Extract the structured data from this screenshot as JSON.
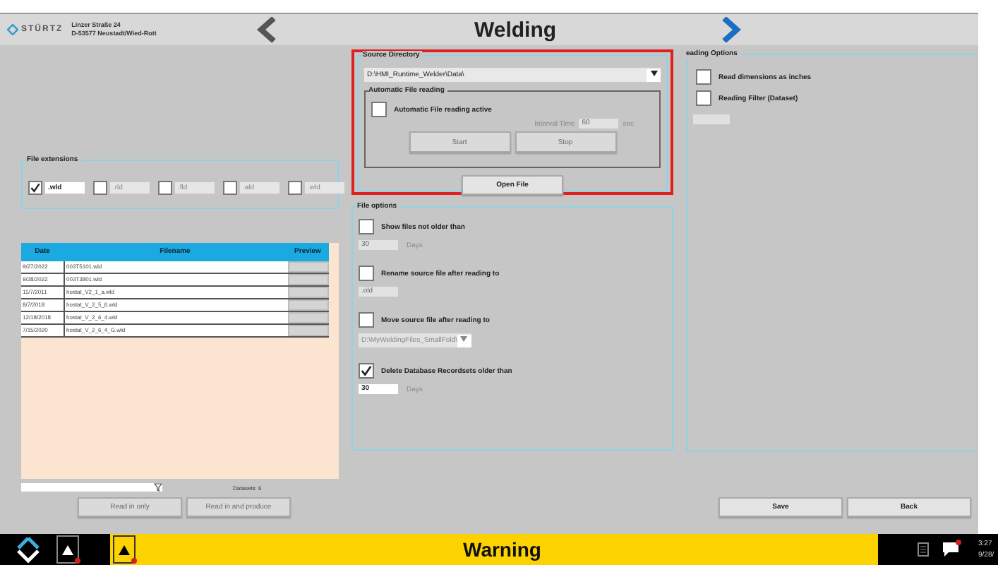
{
  "header": {
    "logo_text": "STÜRTZ",
    "address_lines": [
      "Linzer Straße 24",
      "D-53577 Neustadt/Wied-Rott"
    ],
    "title": "Welding"
  },
  "file_extensions": {
    "label": "File extensions",
    "items": [
      {
        "label": ".wld",
        "checked": true
      },
      {
        "label": ".rld",
        "checked": false
      },
      {
        "label": ".fld",
        "checked": false
      },
      {
        "label": ".ald",
        "checked": false
      },
      {
        "label": ".wld",
        "checked": false
      }
    ]
  },
  "table": {
    "columns": [
      "Date",
      "Filename",
      "Preview"
    ],
    "rows": [
      {
        "date": "9/27/2022",
        "filename": "003T5101.wld"
      },
      {
        "date": "9/28/2022",
        "filename": "003T3801.wld"
      },
      {
        "date": "11/7/2011",
        "filename": "hostat_V2_1_a.wld"
      },
      {
        "date": "8/7/2018",
        "filename": "hostat_V_2_5_6.wld"
      },
      {
        "date": "12/18/2018",
        "filename": "hostat_V_2_6_4.wld"
      },
      {
        "date": "7/15/2020",
        "filename": "hostat_V_2_6_4_G.wld"
      }
    ],
    "datasets": "Datasets: 6"
  },
  "source_directory": {
    "label": "Source Directory",
    "path": "D:\\HMI_Runtime_Welder\\Data\\",
    "auto_reading": {
      "label": "Automatic File reading",
      "checkbox": {
        "label": "Automatic File reading active",
        "checked": false
      },
      "interval_label": "Interval Time",
      "interval_value": "60",
      "unit": "sec",
      "buttons": [
        {
          "label": "Start",
          "disabled": true
        },
        {
          "label": "Stop",
          "disabled": true
        }
      ]
    },
    "open_button": "Open File"
  },
  "file_options": {
    "label": "File options",
    "options": [
      {
        "kind": "number",
        "label": "Show files not older than",
        "checked": false,
        "value": "30",
        "unit": "Days"
      },
      {
        "kind": "text",
        "label": "Rename source file after reading to",
        "checked": false,
        "value": ".old"
      },
      {
        "kind": "dropdown",
        "label": "Move source file after reading to",
        "checked": false,
        "value": "D:\\MyWeldingFiles_SmallFold\\"
      },
      {
        "kind": "number",
        "label": "Delete Database Recordsets older than",
        "checked": true,
        "value": "30",
        "unit": "Days"
      }
    ]
  },
  "reading_options": {
    "label": "eading Options",
    "items": [
      {
        "label": "Read dimensions as inches",
        "checked": false
      },
      {
        "label": "Reading Filter (Dataset)",
        "checked": false
      }
    ]
  },
  "buttons_left": [
    {
      "label": "Read in only",
      "disabled": true
    },
    {
      "label": "Read in and produce",
      "disabled": true
    }
  ],
  "buttons_right": [
    {
      "label": "Save",
      "disabled": false
    },
    {
      "label": "Back",
      "disabled": false
    }
  ],
  "taskbar": {
    "message": "Warning",
    "time": "3:27",
    "date": "9/28/"
  }
}
